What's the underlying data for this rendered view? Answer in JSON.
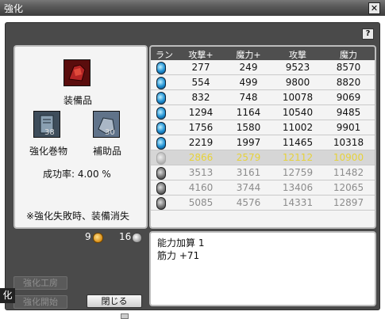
{
  "window": {
    "title": "強化"
  },
  "help_label": "?",
  "close_label": "✕",
  "left": {
    "equip_label": "装備品",
    "scroll_label": "強化巻物",
    "scroll_count": "38",
    "aux_label": "補助品",
    "aux_count": "30",
    "success_rate": "成功率: 4.00 %",
    "warning": "※強化失敗時、装備消失"
  },
  "table": {
    "headers": [
      "ランク",
      "攻撃+",
      "魔力+",
      "攻撃",
      "魔力"
    ],
    "rows": [
      {
        "gem": "blue",
        "atk_plus": "277",
        "mag_plus": "249",
        "atk": "9523",
        "mag": "8570"
      },
      {
        "gem": "blue",
        "atk_plus": "554",
        "mag_plus": "499",
        "atk": "9800",
        "mag": "8820"
      },
      {
        "gem": "blue",
        "atk_plus": "832",
        "mag_plus": "748",
        "atk": "10078",
        "mag": "9069"
      },
      {
        "gem": "blue",
        "atk_plus": "1294",
        "mag_plus": "1164",
        "atk": "10540",
        "mag": "9485"
      },
      {
        "gem": "blue",
        "atk_plus": "1756",
        "mag_plus": "1580",
        "atk": "11002",
        "mag": "9901"
      },
      {
        "gem": "blue",
        "atk_plus": "2219",
        "mag_plus": "1997",
        "atk": "11465",
        "mag": "10318"
      },
      {
        "gem": "faint",
        "atk_plus": "2866",
        "mag_plus": "2579",
        "atk": "12112",
        "mag": "10900"
      },
      {
        "gem": "grey",
        "atk_plus": "3513",
        "mag_plus": "3161",
        "atk": "12759",
        "mag": "11482"
      },
      {
        "gem": "grey",
        "atk_plus": "4160",
        "mag_plus": "3744",
        "atk": "13406",
        "mag": "12065"
      },
      {
        "gem": "grey",
        "atk_plus": "5085",
        "mag_plus": "4576",
        "atk": "14331",
        "mag": "12897"
      }
    ]
  },
  "currency": {
    "gold": "9",
    "silver": "16"
  },
  "result": {
    "lines": [
      "能力加算 1",
      "筋力 +71"
    ]
  },
  "buttons": {
    "workshop": "強化工房",
    "start": "強化開始",
    "close": "閉じる"
  },
  "tooltip": "化",
  "colors": {
    "selected_text": "#e6d23a",
    "future_text": "#8c8c8c",
    "normal_text": "#111111"
  }
}
